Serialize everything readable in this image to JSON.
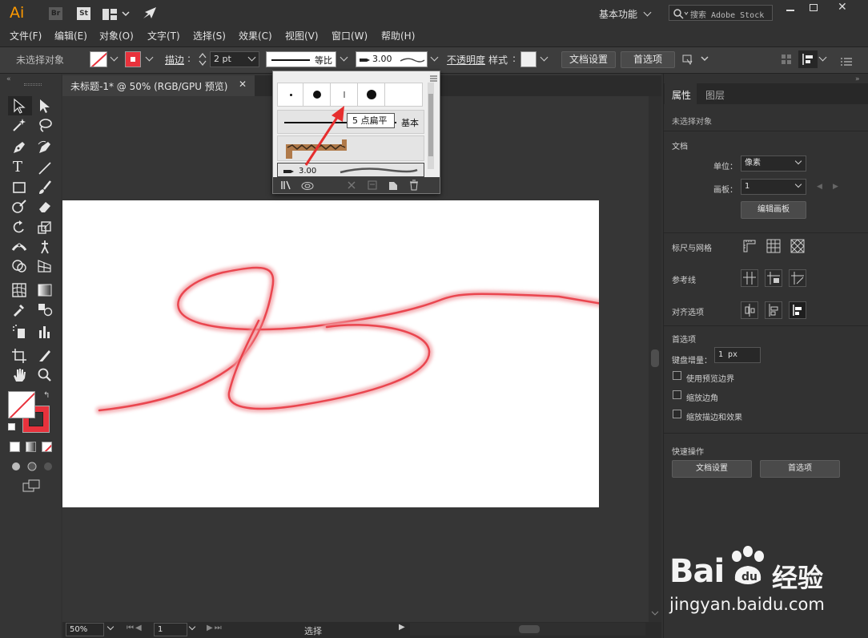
{
  "titlebar": {
    "app_icon": "Ai",
    "bridge": "Br",
    "stock": "St",
    "workspace": "基本功能",
    "search_placeholder": "搜索 Adobe Stock"
  },
  "menus": [
    "文件(F)",
    "编辑(E)",
    "对象(O)",
    "文字(T)",
    "选择(S)",
    "效果(C)",
    "视图(V)",
    "窗口(W)",
    "帮助(H)"
  ],
  "control": {
    "selection": "未选择对象",
    "stroke_label": "描边",
    "stroke_value": "2 pt",
    "profile": "等比",
    "brush_value": "3.00",
    "opacity_label": "不透明度",
    "style_label": "样式",
    "doc_setup": "文档设置",
    "preferences": "首选项"
  },
  "document": {
    "tab_title": "未标题-1* @ 50% (RGB/GPU 预览)"
  },
  "brush_popup": {
    "tooltip": "5 点扁平",
    "basic_label": "基本",
    "row_value": "3.00"
  },
  "status": {
    "zoom": "50%",
    "artboard": "1",
    "tool": "选择"
  },
  "panel": {
    "tab_properties": "属性",
    "tab_layers": "图层",
    "no_selection": "未选择对象",
    "doc_section": "文档",
    "units_label": "单位：",
    "units_value": "像素",
    "artboard_label": "画板：",
    "artboard_value": "1",
    "edit_artboards": "编辑画板",
    "rulers_grids": "标尺与网格",
    "guides": "参考线",
    "align_options": "对齐选项",
    "prefs_section": "首选项",
    "keyboard_increment_label": "键盘增量：",
    "keyboard_increment_value": "1 px",
    "chk_preview_bounds": "使用预览边界",
    "chk_scale_corners": "缩放边角",
    "chk_scale_strokes": "缩放描边和效果",
    "quick_actions": "快速操作",
    "qa_doc_setup": "文档设置",
    "qa_preferences": "首选项"
  },
  "watermark": {
    "logo_text": "Bai",
    "logo_suffix": "经验",
    "url": "jingyan.baidu.com"
  },
  "colors": {
    "brand": "#ff9a00",
    "stroke_red": "#e8323c",
    "ui_bg": "#323232"
  }
}
